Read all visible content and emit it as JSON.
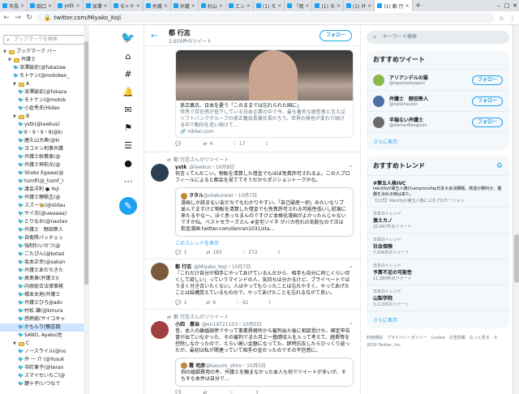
{
  "tabs": [
    {
      "label": "市長"
    },
    {
      "label": "田口"
    },
    {
      "label": "ystk"
    },
    {
      "label": "深澤"
    },
    {
      "label": "モトケ"
    },
    {
      "label": "弁護"
    },
    {
      "label": "弁護"
    },
    {
      "label": "杉山"
    },
    {
      "label": "エン"
    },
    {
      "label": "(1) モ"
    },
    {
      "label": "「岡"
    },
    {
      "label": "(1) モ"
    },
    {
      "label": "(1) 弁"
    },
    {
      "label": "(1) 都 行"
    }
  ],
  "address": {
    "url": "twitter.com/Miyako_Koji"
  },
  "bookmarks": {
    "search_placeholder": "ブックマークを検索",
    "items": [
      {
        "label": "ブックマーク バー",
        "kind": "folder",
        "indent": 0
      },
      {
        "label": "弁護士",
        "kind": "folder",
        "indent": 1
      },
      {
        "label": "深澤諭史(@fukazaw",
        "kind": "tw",
        "indent": 2
      },
      {
        "label": "モトケン(@motoken_",
        "kind": "tw",
        "indent": 2
      },
      {
        "label": "A",
        "kind": "folder",
        "indent": 2
      },
      {
        "label": "深澤諭史(@fukaza",
        "kind": "tw",
        "indent": 3
      },
      {
        "label": "モトケン(@motok",
        "kind": "tw",
        "indent": 3
      },
      {
        "label": "小倉秀夫(Hideo",
        "kind": "tw",
        "indent": 3
      },
      {
        "label": "B",
        "kind": "folder",
        "indent": 2
      },
      {
        "label": "ystk(@lawkus)",
        "kind": "tw",
        "indent": 3
      },
      {
        "label": "K・9・9・9(@ki",
        "kind": "tw",
        "indent": 3
      },
      {
        "label": "唐久山大典(@ki",
        "kind": "tw",
        "indent": 3
      },
      {
        "label": "ヨコテン刑事弁護",
        "kind": "tw",
        "indent": 3
      },
      {
        "label": "弁護士秋葉恵(@",
        "kind": "tw",
        "indent": 3
      },
      {
        "label": "弁護士神前光(@",
        "kind": "tw",
        "indent": 3
      },
      {
        "label": "Shoko Egawa(@",
        "kind": "tw",
        "indent": 3
      },
      {
        "label": "hzmfl(@_hzmf_)",
        "kind": "tw",
        "indent": 3
      },
      {
        "label": "渡会洋利 ● Yoji",
        "kind": "tw",
        "indent": 3
      },
      {
        "label": "弁護士穂積圭(@",
        "kind": "tw",
        "indent": 3
      },
      {
        "label": "スズー🐝(@stdau",
        "kind": "tw",
        "indent": 3
      },
      {
        "label": "サイ次(@uwaaaa)",
        "kind": "tw",
        "indent": 3
      },
      {
        "label": "とりなお(@naotan",
        "kind": "tw",
        "indent": 3
      },
      {
        "label": "弁護士　野田隼人",
        "kind": "tw",
        "indent": 3
      },
      {
        "label": "自衛隊パッチェッ",
        "kind": "tw",
        "indent": 3
      },
      {
        "label": "強制わいせつ(@",
        "kind": "tw",
        "indent": 3
      },
      {
        "label": "ごたぴん(@kotad",
        "kind": "tw",
        "indent": 3
      },
      {
        "label": "坂本正幸(@sakan",
        "kind": "tw",
        "indent": 3
      },
      {
        "label": "弁護士あだちきた",
        "kind": "tw",
        "indent": 3
      },
      {
        "label": "高島章(弁護士)(",
        "kind": "tw",
        "indent": 3
      },
      {
        "label": "向原総合法律事務",
        "kind": "tw",
        "indent": 3
      },
      {
        "label": "橋本太地(弁護士",
        "kind": "tw",
        "indent": 3
      },
      {
        "label": "弁護士ひろ@adv",
        "kind": "tw",
        "indent": 3
      },
      {
        "label": "村松 謙(@kmura",
        "kind": "tw",
        "indent": 3
      },
      {
        "label": "感熱紙(サイコキャ",
        "kind": "tw",
        "indent": 3
      },
      {
        "label": "かもんり(鴨志田",
        "kind": "tw",
        "indent": 3,
        "selected": true
      },
      {
        "label": "SANO, Ayako/佐",
        "kind": "tw",
        "indent": 3
      },
      {
        "label": "C",
        "kind": "folder",
        "indent": 2
      },
      {
        "label": "ノースライル(@no",
        "kind": "tw",
        "indent": 3
      },
      {
        "label": "弁 一 介 (@Yusuk",
        "kind": "tw",
        "indent": 3
      },
      {
        "label": "寺町東子(@teran",
        "kind": "tw",
        "indent": 3
      },
      {
        "label": "スマイセいちご(@",
        "kind": "tw",
        "indent": 3
      },
      {
        "label": "鍵十子(いつなで",
        "kind": "tw",
        "indent": 3
      }
    ]
  },
  "profile": {
    "name": "都 行志",
    "tweet_count": "2,659件のツイート",
    "follow_label": "フォロー"
  },
  "card": {
    "title": "孫正義氏、日本を憂う「このままでは忘れられた国に」",
    "desc": "世界で存在感が低下している日本企業の中で今、最も著名な経営者と言えばソフトバンクグループの孫正義会長兼社長だろう。世界の景色が変わり続ける中で動向を追い続けて…",
    "url": "nikkei.com",
    "actions": {
      "reply": "",
      "rt": "4",
      "like": "17"
    }
  },
  "tweets": [
    {
      "rt_by": "都 行志さんがリツイート",
      "name": "ystk",
      "handle": "@lawkus・10月8日",
      "text": "何言ってんだこい。物販を清算した借金でもほぼ免責許可されるよ。この人プロフィールによると都会を見ててそうだからポジショントークかな。",
      "quote": {
        "name": "ヲタル",
        "handle": "@otakurarei・10月7日",
        "text": "漫画しか読まない友だちでもわかりやすい。「自己破産一択」みたいなリプ並んでますけど物販を清算した借金でも免責許可される可能性低いし慰謝に来たるやなー。ほぐ思っちまんのですけど本格化漫画がよかったんじゃないですかね。ベストセラーズさん #金宅ソイネ がバカ売れの気配なので次は街金漫画 twitter.com/denran1031/sta..."
      },
      "thread_link": "このスレッドを表示",
      "actions": {
        "reply": "1",
        "rt": "165",
        "like": "272"
      }
    },
    {
      "rt_by": "",
      "name": "都 行志",
      "handle": "@Miyako_Koji・10月7日",
      "text": "「これだけ自分が相手にやってあげているんだから、相手も自分に同じくらい尽くして欲しい」っていうマインドの人、気持ちは分かるけど、プライベートではうまく付き合いたくない。人はやってもらったことは忘れやすく、やってあげたことは結構覚えているものので、やってあげたことを忘れる位がて良い。",
      "actions": {
        "reply": "1",
        "rt": "6",
        "like": "42"
      }
    },
    {
      "rt_by": "都 行志さんがリツイート",
      "name": "小四　惠治",
      "handle": "@en19721103・10月5日",
      "text": "昔、本人の離婚調停でやって事業費務所から審判出た後に相談受けた、確定申告書が出ていなかった、その審判でまた月上一基礎収入を入って考えて、経費等を控除しなかったので、えらい高い金額になってた、即時抗告したらひっくり返ったが、最初は私が関連っていて相手の金だったのでその不信感に。",
      "quote": {
        "name": "霞 司彦",
        "handle": "@kasumi_shiro・10月5日",
        "text": "例の婚姻費用の件、弁護士を頼まなかった本人も何でツイートが多いが、そもそも本件は自分で..."
      },
      "actions": {
        "reply": "",
        "rt": "",
        "like": ""
      }
    }
  ],
  "right": {
    "search_placeholder": "キーワード検索",
    "who_title": "おすすめツイート",
    "who": [
      {
        "name": "アリアンデルの猫",
        "handle": "@taparkadejapon",
        "btn": "フォロー",
        "color": "#8ab84a"
      },
      {
        "name": "弁護士　野田隼人",
        "handle": "@nodahayato",
        "btn": "フォロー",
        "color": "#4a6fa5"
      },
      {
        "name": "半端ない弁護士",
        "handle": "@ikemenBengoshi",
        "btn": "フォロー",
        "color": "#6b6b6b"
      }
    ],
    "more": "さらに表示",
    "trend_title": "おすすめトレンド",
    "trends": [
      {
        "label": "",
        "title": "#第五人格IVC",
        "desc": "IdentityV第五人格Championship日本大会決勝戦、敗退か勝利か、優勝を決める時は来た。",
        "count": "【公式】IdentityV第五人格によるプロモーション"
      },
      {
        "label": "日本のトレンド",
        "title": "激えカノ",
        "desc": "",
        "count": "22,697件のツイート"
      },
      {
        "label": "日本のトレンド",
        "title": "社会保険",
        "desc": "",
        "count": "7,506件のツイート"
      },
      {
        "label": "日本のトレンド",
        "title": "予算不足の可能性",
        "desc": "",
        "count": "11,280件のツイート"
      },
      {
        "label": "日本のトレンド",
        "title": "山梨学院",
        "desc": "",
        "count": "3,113件のツイート"
      }
    ],
    "footer": [
      "利用規約",
      "プライバシーポリシー",
      "Cookie",
      "広告情報",
      "もっと見る",
      "© 2019 Twitter, Inc."
    ]
  }
}
